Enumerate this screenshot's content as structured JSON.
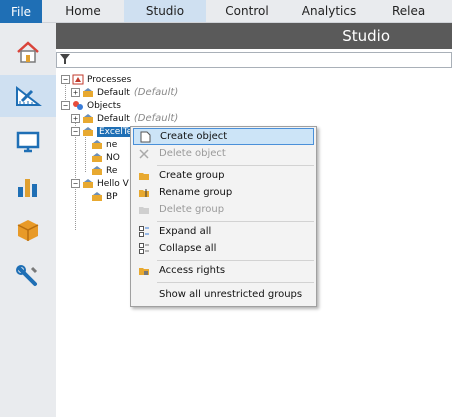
{
  "menubar": {
    "file_label": "File",
    "tabs": [
      {
        "label": "Home"
      },
      {
        "label": "Studio"
      },
      {
        "label": "Control"
      },
      {
        "label": "Analytics"
      },
      {
        "label": "Relea"
      }
    ]
  },
  "leftnav": {
    "items": [
      {
        "icon": "home-icon"
      },
      {
        "icon": "studio-icon"
      },
      {
        "icon": "monitor-icon"
      },
      {
        "icon": "analytics-icon"
      },
      {
        "icon": "package-icon"
      },
      {
        "icon": "tools-icon"
      }
    ]
  },
  "titlebar": {
    "title": "Studio"
  },
  "tree": {
    "processes_label": "Processes",
    "processes_default_label": "Default",
    "processes_default_note": "(Default)",
    "objects_label": "Objects",
    "objects_default_label": "Default",
    "objects_default_note": "(Default)",
    "selected_group_label": "ExcelTe",
    "child_1": "ne",
    "child_2": "NO",
    "child_3": "Re",
    "hello_label": "Hello V",
    "hello_child": "BP"
  },
  "context_menu": {
    "create_object": "Create object",
    "delete_object": "Delete object",
    "create_group": "Create group",
    "rename_group": "Rename group",
    "delete_group": "Delete group",
    "expand_all": "Expand all",
    "collapse_all": "Collapse all",
    "access_rights": "Access rights",
    "show_unrestricted": "Show all unrestricted groups"
  },
  "colors": {
    "accent": "#1f6fb5",
    "active_tab": "#cfe0f1",
    "titlebar": "#5a5a5a",
    "menu_highlight": "#cce4f7"
  }
}
